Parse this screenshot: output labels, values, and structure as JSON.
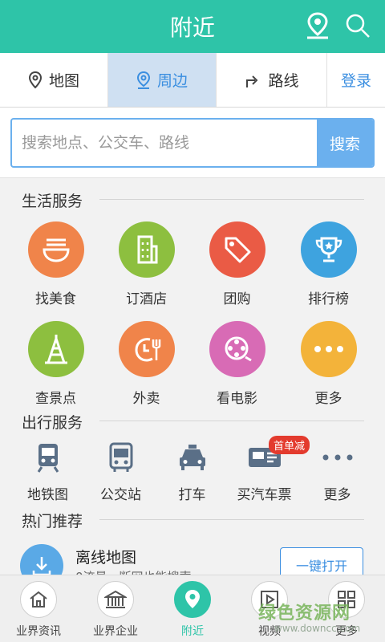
{
  "header": {
    "title": "附近",
    "location_icon": "location-pin-icon",
    "search_icon": "search-icon"
  },
  "tabs": {
    "map": "地图",
    "nearby": "周边",
    "route": "路线",
    "login": "登录"
  },
  "search": {
    "placeholder": "搜索地点、公交车、路线",
    "button": "搜索"
  },
  "life": {
    "title": "生活服务",
    "items": [
      {
        "label": "找美食",
        "color": "#f0844a",
        "icon": "noodle-bowl-icon"
      },
      {
        "label": "订酒店",
        "color": "#8dbf3f",
        "icon": "hotel-building-icon"
      },
      {
        "label": "团购",
        "color": "#ea5b45",
        "icon": "tag-icon"
      },
      {
        "label": "排行榜",
        "color": "#3ea3df",
        "icon": "trophy-icon"
      },
      {
        "label": "查景点",
        "color": "#8dbf3f",
        "icon": "tower-icon"
      },
      {
        "label": "外卖",
        "color": "#f0844a",
        "icon": "takeout-fork-icon"
      },
      {
        "label": "看电影",
        "color": "#d86bb5",
        "icon": "film-reel-icon"
      },
      {
        "label": "更多",
        "color": "#f3b33a",
        "icon": "more-dots-icon"
      }
    ]
  },
  "travel": {
    "title": "出行服务",
    "items": [
      {
        "label": "地铁图",
        "icon": "subway-icon"
      },
      {
        "label": "公交站",
        "icon": "bus-icon"
      },
      {
        "label": "打车",
        "icon": "taxi-icon"
      },
      {
        "label": "买汽车票",
        "icon": "bus-ticket-icon"
      },
      {
        "label": "更多",
        "icon": "more-dots-icon"
      }
    ],
    "badge": "首单减"
  },
  "hot": {
    "title": "热门推荐",
    "item_title": "离线地图",
    "item_desc": "0流量，断网也能搜索",
    "button": "一键打开"
  },
  "bottom_nav": [
    {
      "label": "业界资讯",
      "icon": "home-icon"
    },
    {
      "label": "业界企业",
      "icon": "building-icon"
    },
    {
      "label": "附近",
      "icon": "location-pin-icon"
    },
    {
      "label": "视频",
      "icon": "video-play-icon"
    },
    {
      "label": "更多",
      "icon": "grid-icon"
    }
  ],
  "watermark": {
    "text": "绿色资源网",
    "url": "www.downcc.com"
  },
  "colors": {
    "header": "#2ec4a8",
    "accent_blue": "#3a8ee0",
    "search_blue": "#6bb0ee"
  }
}
